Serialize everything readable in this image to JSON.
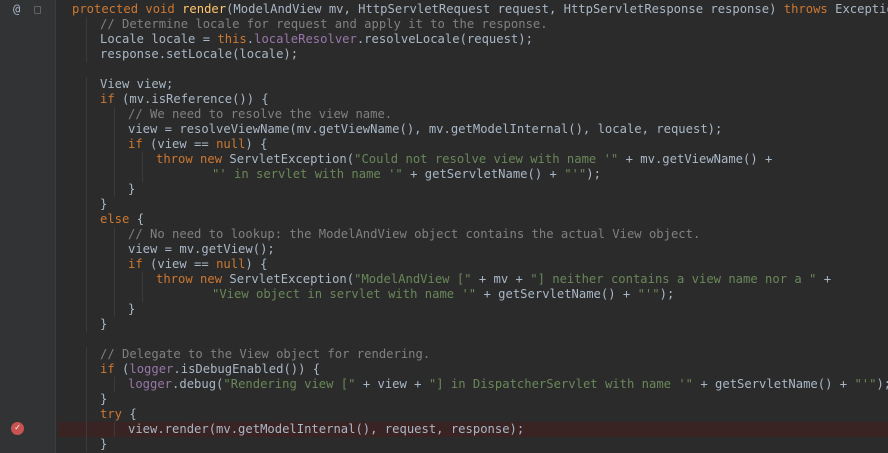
{
  "editor": {
    "lines": [
      {
        "indent": 0,
        "tokens": [
          [
            "kw",
            "protected void "
          ],
          [
            "fn",
            "render"
          ],
          [
            "pl",
            "(ModelAndView mv, HttpServletRequest request, HttpServletResponse response) "
          ],
          [
            "kw",
            "throws "
          ],
          [
            "pl",
            "Exception {"
          ]
        ]
      },
      {
        "indent": 1,
        "tokens": [
          [
            "cm",
            "// Determine locale for request and apply it to the response."
          ]
        ]
      },
      {
        "indent": 1,
        "tokens": [
          [
            "pl",
            "Locale locale = "
          ],
          [
            "kw",
            "this"
          ],
          [
            "pl",
            "."
          ],
          [
            "fld",
            "localeResolver"
          ],
          [
            "pl",
            ".resolveLocale(request);"
          ]
        ]
      },
      {
        "indent": 1,
        "tokens": [
          [
            "pl",
            "response.setLocale(locale);"
          ]
        ]
      },
      {
        "indent": 0,
        "tokens": []
      },
      {
        "indent": 1,
        "tokens": [
          [
            "pl",
            "View view;"
          ]
        ]
      },
      {
        "indent": 1,
        "tokens": [
          [
            "kw",
            "if "
          ],
          [
            "pl",
            "(mv.isReference()) {"
          ]
        ]
      },
      {
        "indent": 2,
        "tokens": [
          [
            "cm",
            "// We need to resolve the view name."
          ]
        ]
      },
      {
        "indent": 2,
        "tokens": [
          [
            "pl",
            "view = resolveViewName(mv.getViewName(), mv.getModelInternal(), locale, request);"
          ]
        ]
      },
      {
        "indent": 2,
        "tokens": [
          [
            "kw",
            "if "
          ],
          [
            "pl",
            "(view == "
          ],
          [
            "kw",
            "null"
          ],
          [
            "pl",
            ") {"
          ]
        ]
      },
      {
        "indent": 3,
        "tokens": [
          [
            "kw",
            "throw new "
          ],
          [
            "pl",
            "ServletException("
          ],
          [
            "str",
            "\"Could not resolve view with name '\""
          ],
          [
            "pl",
            " + mv.getViewName() +"
          ]
        ]
      },
      {
        "indent": 5,
        "tokens": [
          [
            "str",
            "\"' in servlet with name '\""
          ],
          [
            "pl",
            " + getServletName() + "
          ],
          [
            "str",
            "\"'\""
          ],
          [
            "pl",
            ");"
          ]
        ]
      },
      {
        "indent": 2,
        "tokens": [
          [
            "pl",
            "}"
          ]
        ]
      },
      {
        "indent": 1,
        "tokens": [
          [
            "pl",
            "}"
          ]
        ]
      },
      {
        "indent": 1,
        "tokens": [
          [
            "kw",
            "else "
          ],
          [
            "pl",
            "{"
          ]
        ]
      },
      {
        "indent": 2,
        "tokens": [
          [
            "cm",
            "// No need to lookup: the ModelAndView object contains the actual View object."
          ]
        ]
      },
      {
        "indent": 2,
        "tokens": [
          [
            "pl",
            "view = mv.getView();"
          ]
        ]
      },
      {
        "indent": 2,
        "tokens": [
          [
            "kw",
            "if "
          ],
          [
            "pl",
            "(view == "
          ],
          [
            "kw",
            "null"
          ],
          [
            "pl",
            ") {"
          ]
        ]
      },
      {
        "indent": 3,
        "tokens": [
          [
            "kw",
            "throw new "
          ],
          [
            "pl",
            "ServletException("
          ],
          [
            "str",
            "\"ModelAndView [\""
          ],
          [
            "pl",
            " + mv + "
          ],
          [
            "str",
            "\"] neither contains a view name nor a \""
          ],
          [
            "pl",
            " +"
          ]
        ]
      },
      {
        "indent": 5,
        "tokens": [
          [
            "str",
            "\"View object in servlet with name '\""
          ],
          [
            "pl",
            " + getServletName() + "
          ],
          [
            "str",
            "\"'\""
          ],
          [
            "pl",
            ");"
          ]
        ]
      },
      {
        "indent": 2,
        "tokens": [
          [
            "pl",
            "}"
          ]
        ]
      },
      {
        "indent": 1,
        "tokens": [
          [
            "pl",
            "}"
          ]
        ]
      },
      {
        "indent": 0,
        "tokens": []
      },
      {
        "indent": 1,
        "tokens": [
          [
            "cm",
            "// Delegate to the View object for rendering."
          ]
        ]
      },
      {
        "indent": 1,
        "tokens": [
          [
            "kw",
            "if "
          ],
          [
            "pl",
            "("
          ],
          [
            "fld",
            "logger"
          ],
          [
            "pl",
            ".isDebugEnabled()) {"
          ]
        ]
      },
      {
        "indent": 2,
        "tokens": [
          [
            "fld",
            "logger"
          ],
          [
            "pl",
            ".debug("
          ],
          [
            "str",
            "\"Rendering view [\""
          ],
          [
            "pl",
            " + view + "
          ],
          [
            "str",
            "\"] in DispatcherServlet with name '\""
          ],
          [
            "pl",
            " + getServletName() + "
          ],
          [
            "str",
            "\"'\""
          ],
          [
            "pl",
            ");"
          ]
        ]
      },
      {
        "indent": 1,
        "tokens": [
          [
            "pl",
            "}"
          ]
        ]
      },
      {
        "indent": 1,
        "tokens": [
          [
            "kw",
            "try "
          ],
          [
            "pl",
            "{"
          ]
        ]
      },
      {
        "indent": 2,
        "breakpoint": true,
        "tokens": [
          [
            "pl",
            "view.render(mv.getModelInternal(), request, response);"
          ]
        ]
      },
      {
        "indent": 1,
        "tokens": [
          [
            "pl",
            "}"
          ]
        ]
      }
    ]
  },
  "gutter": {
    "override_icon": "at-sign-icon",
    "override_glyph": "@",
    "breakpoint_icon": "breakpoint-check-icon",
    "breakpoint_glyph": "✓"
  },
  "colors": {
    "background": "#2b2b2b",
    "keyword": "#cc7832",
    "method": "#ffc66d",
    "string": "#6a8759",
    "comment": "#808080",
    "field": "#9876aa",
    "plain": "#a9b7c6",
    "breakpoint": "#c75450"
  }
}
